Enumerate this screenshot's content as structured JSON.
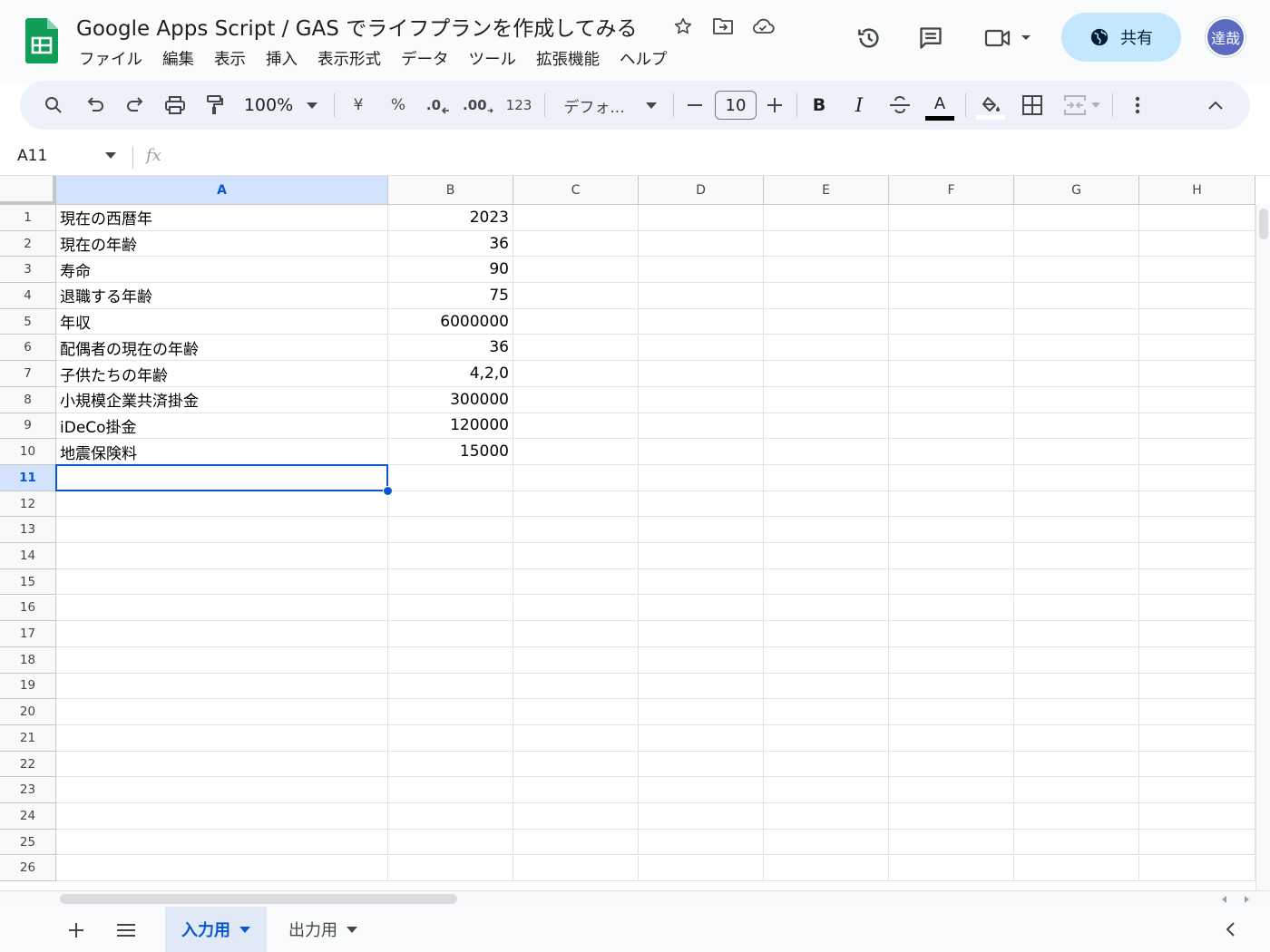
{
  "header": {
    "doc_title": "Google Apps Script / GAS でライフプランを作成してみる",
    "share_label": "共有",
    "avatar_text": "達哉"
  },
  "menu": [
    "ファイル",
    "編集",
    "表示",
    "挿入",
    "表示形式",
    "データ",
    "ツール",
    "拡張機能",
    "ヘルプ"
  ],
  "toolbar": {
    "zoom": "100%",
    "currency": "¥",
    "percent": "%",
    "dec_decrease": ".0",
    "dec_increase": ".00",
    "number_format": "123",
    "font": "デフォ...",
    "font_size": "10",
    "bold": "B",
    "italic": "I",
    "text_color_label": "A"
  },
  "formula_bar": {
    "cell_ref": "A11",
    "fx": "fx"
  },
  "grid": {
    "columns": [
      "A",
      "B",
      "C",
      "D",
      "E",
      "F",
      "G",
      "H"
    ],
    "rows": [
      "1",
      "2",
      "3",
      "4",
      "5",
      "6",
      "7",
      "8",
      "9",
      "10",
      "11",
      "12",
      "13",
      "14",
      "15",
      "16",
      "17",
      "18",
      "19",
      "20",
      "21",
      "22",
      "23",
      "24",
      "25",
      "26"
    ],
    "cells": [
      {
        "a": "現在の西暦年",
        "b": "2023"
      },
      {
        "a": "現在の年齢",
        "b": "36"
      },
      {
        "a": "寿命",
        "b": "90"
      },
      {
        "a": "退職する年齢",
        "b": "75"
      },
      {
        "a": "年収",
        "b": "6000000"
      },
      {
        "a": "配偶者の現在の年齢",
        "b": "36"
      },
      {
        "a": "子供たちの年齢",
        "b": "4,2,0"
      },
      {
        "a": "小規模企業共済掛金",
        "b": "300000"
      },
      {
        "a": "iDeCo掛金",
        "b": "120000"
      },
      {
        "a": "地震保険料",
        "b": "15000"
      }
    ],
    "selected_cell": "A11",
    "selected_row": "11",
    "selected_col": "A"
  },
  "sheets": [
    {
      "label": "入力用",
      "active": true
    },
    {
      "label": "出力用",
      "active": false
    }
  ],
  "colors": {
    "accent": "#0b57d0",
    "share_bg": "#c2e7ff",
    "sheets_green": "#0f9d58"
  }
}
